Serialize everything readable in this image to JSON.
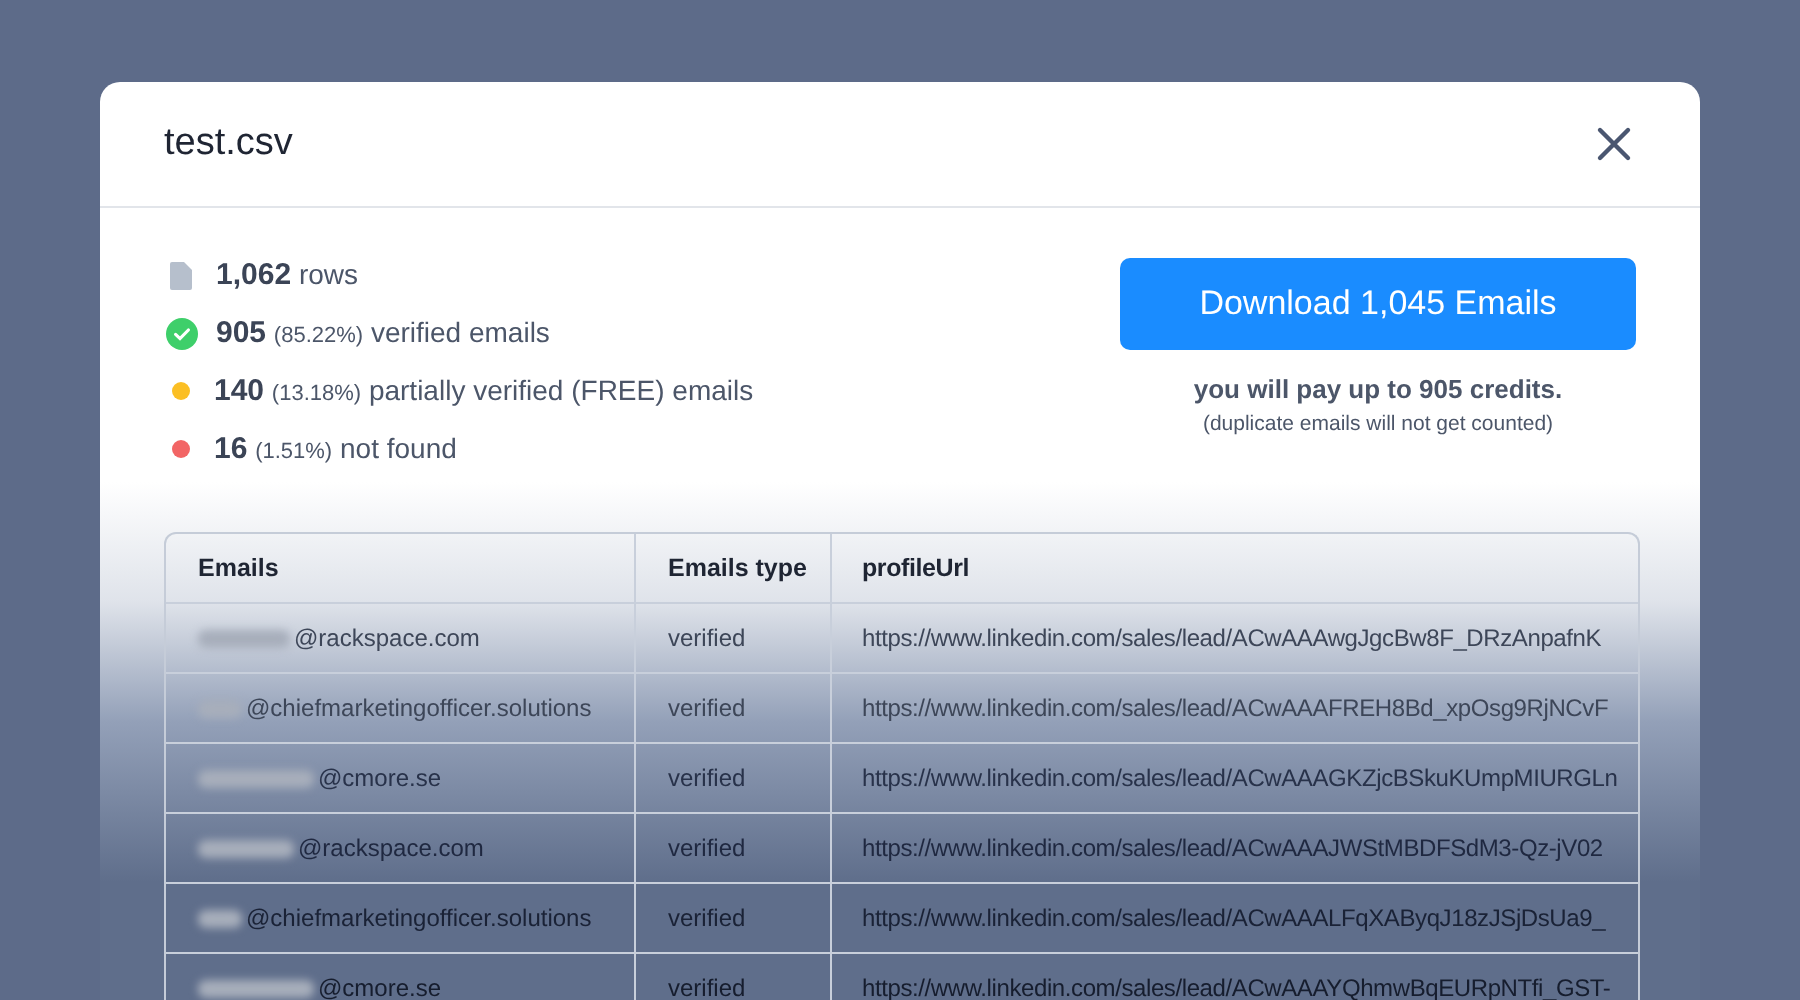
{
  "dialog": {
    "title": "test.csv"
  },
  "stats": [
    {
      "kind": "file",
      "count": "1,062",
      "label": "rows"
    },
    {
      "kind": "dot",
      "color": "#3ecf6a",
      "check": true,
      "count": "905",
      "percent": "(85.22%)",
      "label": "verified emails"
    },
    {
      "kind": "dot",
      "color": "#fbbf24",
      "check": false,
      "count": "140",
      "percent": "(13.18%)",
      "label": "partially verified (FREE) emails"
    },
    {
      "kind": "dot",
      "color": "#f26565",
      "check": false,
      "count": "16",
      "percent": "(1.51%)",
      "label": "not found"
    }
  ],
  "download": {
    "button": "Download 1,045 Emails",
    "note": "you will pay up to 905 credits.",
    "subnote": "(duplicate emails will not get counted)"
  },
  "table": {
    "columns": [
      "Emails",
      "Emails type",
      "profileUrl"
    ],
    "rows": [
      {
        "email_domain": "@rackspace.com",
        "type": "verified",
        "url": "https://www.linkedin.com/sales/lead/ACwAAAwgJgcBw8F_DRzAnpafnK"
      },
      {
        "email_domain": "@chiefmarketingofficer.solutions",
        "type": "verified",
        "url": "https://www.linkedin.com/sales/lead/ACwAAAFREH8Bd_xpOsg9RjNCvF"
      },
      {
        "email_domain": "@cmore.se",
        "type": "verified",
        "url": "https://www.linkedin.com/sales/lead/ACwAAAGKZjcBSkuKUmpMIURGLn"
      },
      {
        "email_domain": "@rackspace.com",
        "type": "verified",
        "url": "https://www.linkedin.com/sales/lead/ACwAAAJWStMBDFSdM3-Qz-jV02"
      },
      {
        "email_domain": "@chiefmarketingofficer.solutions",
        "type": "verified",
        "url": "https://www.linkedin.com/sales/lead/ACwAAALFqXAByqJ18zJSjDsUa9_"
      },
      {
        "email_domain": "@cmore.se",
        "type": "verified",
        "url": "https://www.linkedin.com/sales/lead/ACwAAAYQhmwBqEURpNTfi_GST-"
      }
    ]
  }
}
